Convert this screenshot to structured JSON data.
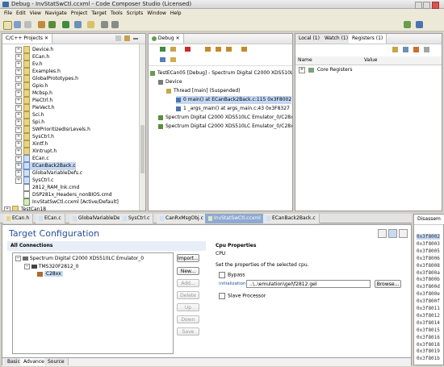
{
  "window": {
    "title": "Debug - InvStatSwCtl.ccxml - Code Composer Studio (Licensed)"
  },
  "menu": [
    "File",
    "Edit",
    "View",
    "Navigate",
    "Project",
    "Target",
    "Tools",
    "Scripts",
    "Window",
    "Help"
  ],
  "projects_panel": {
    "tab_label": "C/C++ Projects",
    "items": [
      {
        "label": "Device.h",
        "kind": "h"
      },
      {
        "label": "ECan.h",
        "kind": "h"
      },
      {
        "label": "Ev.h",
        "kind": "h"
      },
      {
        "label": "Examples.h",
        "kind": "h"
      },
      {
        "label": "GlobalPrototypes.h",
        "kind": "h"
      },
      {
        "label": "Gpio.h",
        "kind": "h"
      },
      {
        "label": "Mcbsp.h",
        "kind": "h"
      },
      {
        "label": "PieCtrl.h",
        "kind": "h"
      },
      {
        "label": "PieVect.h",
        "kind": "h"
      },
      {
        "label": "Sci.h",
        "kind": "h"
      },
      {
        "label": "Spi.h",
        "kind": "h"
      },
      {
        "label": "SWPrioritizedIsrLevels.h",
        "kind": "h"
      },
      {
        "label": "SysCtrl.h",
        "kind": "h"
      },
      {
        "label": "Xintf.h",
        "kind": "h"
      },
      {
        "label": "XIntrupt.h",
        "kind": "h"
      },
      {
        "label": "ECan.c",
        "kind": "c"
      },
      {
        "label": "ECanBack2Back.c",
        "kind": "c"
      },
      {
        "label": "GlobalVariableDefs.c",
        "kind": "c"
      },
      {
        "label": "SysCtrl.c",
        "kind": "c"
      },
      {
        "label": "2812_RAM_lnk.cmd",
        "kind": "cmd"
      },
      {
        "label": "DSP281x_Headers_nonBIOS.cmd",
        "kind": "cmd"
      },
      {
        "label": "InvStatSwCtl.ccxml [Active/Default]",
        "kind": "cc"
      },
      {
        "label": "TestCan18",
        "kind": "h"
      }
    ]
  },
  "debug_panel": {
    "tab_label": "Debug",
    "rows": [
      {
        "label": "TestECan05 [Debug] - Spectrum Digital C2000 XDS510LC Emulator_0/C28xx"
      },
      {
        "label": "Device"
      },
      {
        "label": "Thread [main] (Suspended)"
      },
      {
        "label": "0 main() at ECanBack2Back.c:115 0x3F8002"
      },
      {
        "label": "1 _args_main() at args_main.c:43 0x3F8327"
      },
      {
        "label": "Spectrum Digital C2000 XDS510LC Emulator_0/C28xx (Suspended)"
      },
      {
        "label": "Spectrum Digital C2000 XDS510LC Emulator_0/C28xx: (Running)"
      }
    ]
  },
  "registers_panel": {
    "tabs": [
      "Local (1)",
      "Watch (1)",
      "Registers (1)"
    ],
    "columns": [
      "Name",
      "Value"
    ],
    "rows": [
      {
        "name": "Core Registers",
        "value": ""
      }
    ]
  },
  "editor_tabs": [
    "ECan.h",
    "ECan.c",
    "GlobalVariableDefs.c",
    "SysCtrl.c",
    "CanRxMsgObj.c",
    "InvStatSwCtl.ccxml",
    "ECanBack2Back.c"
  ],
  "target_config": {
    "title": "Target Configuration",
    "connections_label": "All Connections",
    "tree": [
      {
        "label": "Spectrum Digital C2000 XDS510LC Emulator_0"
      },
      {
        "label": "TMS320F2812_0"
      },
      {
        "label": "C28xx"
      }
    ],
    "buttons": {
      "import": "Import...",
      "new": "New...",
      "add": "Add...",
      "delete": "Delete",
      "up": "Up",
      "down": "Down",
      "save": "Save"
    },
    "props": {
      "heading": "Cpu Properties",
      "cpu": "CPU",
      "description": "Set the properties of the selected cpu.",
      "bypass": "Bypass",
      "init_label": "initialization script",
      "init_value": "..\\..\\emulation\\gel\\f2812.gel",
      "browse": "Browse...",
      "slave": "Slave Processor"
    },
    "bottom_tabs": [
      "Basic",
      "Advanced",
      "Source"
    ]
  },
  "disassembly": {
    "tab_label": "Disassem",
    "lines": [
      "0x3f8002",
      "0x3f8003",
      "0x3f8005",
      "0x3f8006",
      "0x3f8008",
      "0x3f800a",
      "0x3f800b",
      "0x3f800d",
      "0x3f800e",
      "0x3f800f",
      "0x3f8011",
      "0x3f8012",
      "0x3f8014",
      "0x3f8015",
      "0x3f8016",
      "0x3f8018",
      "0x3f8019",
      "0x3f801b"
    ]
  }
}
